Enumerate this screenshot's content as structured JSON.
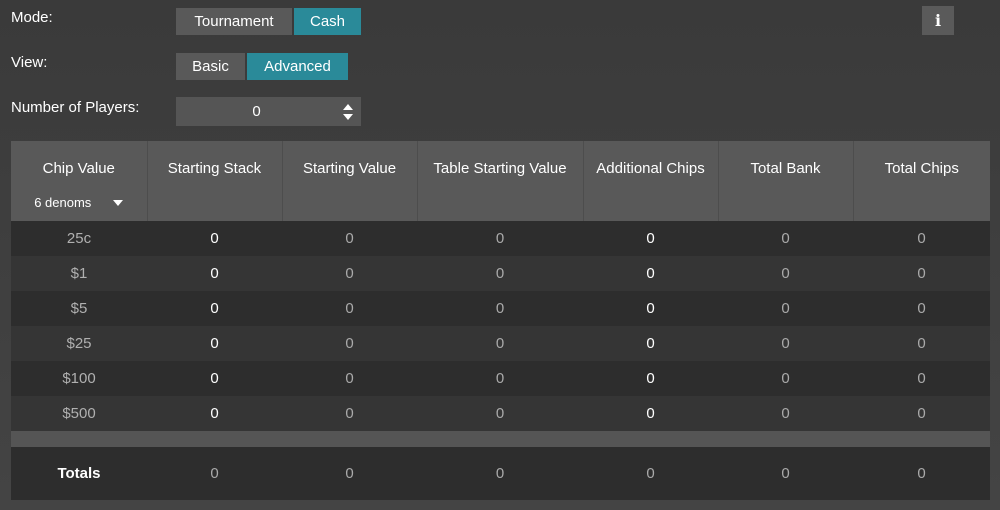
{
  "mode": {
    "label": "Mode:",
    "options": [
      "Tournament",
      "Cash"
    ],
    "selected": "Cash"
  },
  "view": {
    "label": "View:",
    "options": [
      "Basic",
      "Advanced"
    ],
    "selected": "Advanced"
  },
  "players": {
    "label": "Number of Players:",
    "value": "0"
  },
  "info": {
    "icon": "info-icon",
    "glyph": "i"
  },
  "table": {
    "headers": [
      "Chip Value",
      "Starting Stack",
      "Starting Value",
      "Table Starting Value",
      "Additional Chips",
      "Total Bank",
      "Total Chips"
    ],
    "denoms_label": "6 denoms",
    "rows": [
      [
        "25c",
        "0",
        "0",
        "0",
        "0",
        "0",
        "0"
      ],
      [
        "$1",
        "0",
        "0",
        "0",
        "0",
        "0",
        "0"
      ],
      [
        "$5",
        "0",
        "0",
        "0",
        "0",
        "0",
        "0"
      ],
      [
        "$25",
        "0",
        "0",
        "0",
        "0",
        "0",
        "0"
      ],
      [
        "$100",
        "0",
        "0",
        "0",
        "0",
        "0",
        "0"
      ],
      [
        "$500",
        "0",
        "0",
        "0",
        "0",
        "0",
        "0"
      ]
    ],
    "totals": [
      "Totals",
      "0",
      "0",
      "0",
      "0",
      "0",
      "0"
    ]
  },
  "colors": {
    "accent": "#2a8a99",
    "button": "#595959",
    "background": "#3f3f3f"
  }
}
